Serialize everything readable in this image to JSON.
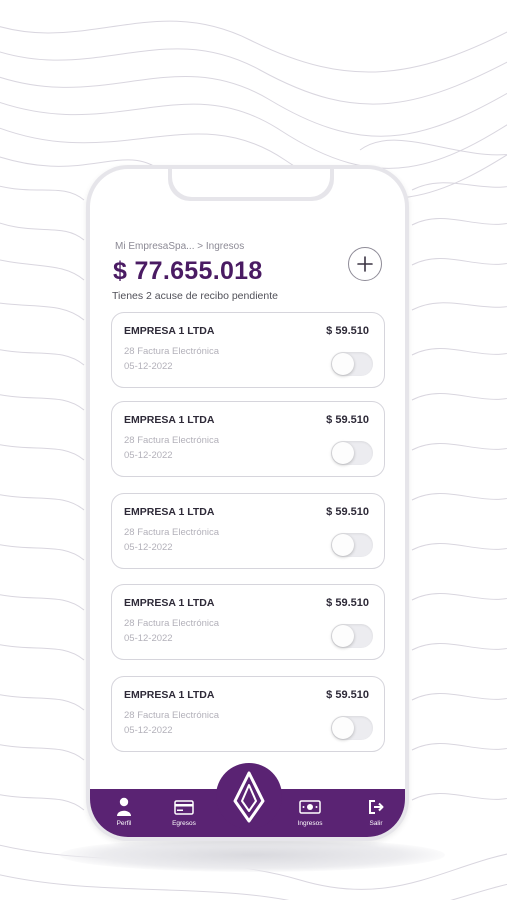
{
  "breadcrumb": "Mi EmpresaSpa... > Ingresos",
  "balance": "$ 77.655.018",
  "pending_notice": "Tienes 2 acuse de recibo pendiente",
  "add_button": {
    "icon": "plus-icon"
  },
  "invoices": [
    {
      "company": "EMPRESA 1 LTDA",
      "amount": "$ 59.510",
      "doc": "28 Factura Electrónica",
      "date": "05-12-2022",
      "acknowledged": false
    },
    {
      "company": "EMPRESA 1 LTDA",
      "amount": "$ 59.510",
      "doc": "28 Factura Electrónica",
      "date": "05-12-2022",
      "acknowledged": false
    },
    {
      "company": "EMPRESA 1 LTDA",
      "amount": "$ 59.510",
      "doc": "28 Factura Electrónica",
      "date": "05-12-2022",
      "acknowledged": false
    },
    {
      "company": "EMPRESA 1 LTDA",
      "amount": "$ 59.510",
      "doc": "28 Factura Electrónica",
      "date": "05-12-2022",
      "acknowledged": false
    },
    {
      "company": "EMPRESA 1 LTDA",
      "amount": "$ 59.510",
      "doc": "28 Factura Electrónica",
      "date": "05-12-2022",
      "acknowledged": false
    }
  ],
  "nav": {
    "perfil": {
      "label": "Perfil",
      "icon": "user-icon"
    },
    "egresos": {
      "label": "Egresos",
      "icon": "card-icon"
    },
    "home": {
      "icon": "logo-icon"
    },
    "ingresos": {
      "label": "Ingresos",
      "icon": "cash-icon"
    },
    "salir": {
      "label": "Salir",
      "icon": "logout-icon"
    }
  },
  "colors": {
    "brand": "#5a2373",
    "balance_text": "#4a1b63",
    "card_border": "#d6d5dc"
  }
}
